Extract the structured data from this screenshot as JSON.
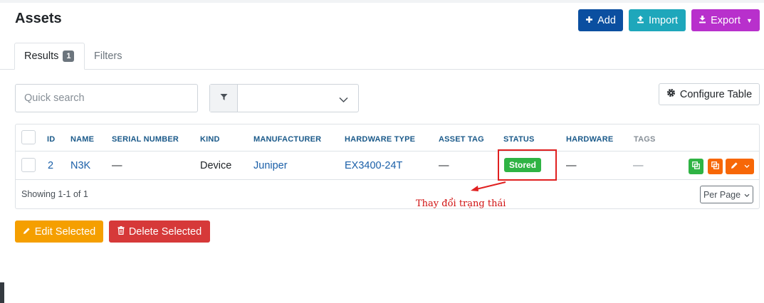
{
  "page": {
    "title": "Assets"
  },
  "toolbar": {
    "add_label": "Add",
    "import_label": "Import",
    "export_label": "Export"
  },
  "tabs": [
    {
      "label": "Results",
      "badge": "1",
      "active": true
    },
    {
      "label": "Filters",
      "active": false
    }
  ],
  "search": {
    "placeholder": "Quick search",
    "value": ""
  },
  "filter": {
    "selected": ""
  },
  "configure_table_label": "Configure Table",
  "table": {
    "columns": [
      "ID",
      "NAME",
      "SERIAL NUMBER",
      "KIND",
      "MANUFACTURER",
      "HARDWARE TYPE",
      "ASSET TAG",
      "STATUS",
      "HARDWARE",
      "TAGS"
    ],
    "rows": [
      {
        "id": "2",
        "name": "N3K",
        "serial_number": "—",
        "kind": "Device",
        "manufacturer": "Juniper",
        "hardware_type": "EX3400-24T",
        "asset_tag": "—",
        "status": "Stored",
        "hardware": "—",
        "tags": "—"
      }
    ],
    "footer": "Showing 1-1 of 1",
    "per_page_label": "Per Page"
  },
  "annotation": {
    "text": "Thay đổi trạng thái",
    "color": "#d01010"
  },
  "bulk_actions": {
    "edit_label": "Edit Selected",
    "delete_label": "Delete Selected"
  },
  "colors": {
    "add": "#0b4fa0",
    "import": "#1ea7bb",
    "export": "#b830cc",
    "status_stored": "#2fb344",
    "edit_selected": "#f59f00",
    "delete_selected": "#d63939"
  },
  "icons": [
    "plus-icon",
    "upload-icon",
    "download-icon",
    "caret-down-icon",
    "filter-icon",
    "chevron-down-icon",
    "gear-icon",
    "clone-icon",
    "copy-icon",
    "pencil-icon",
    "trash-icon"
  ]
}
